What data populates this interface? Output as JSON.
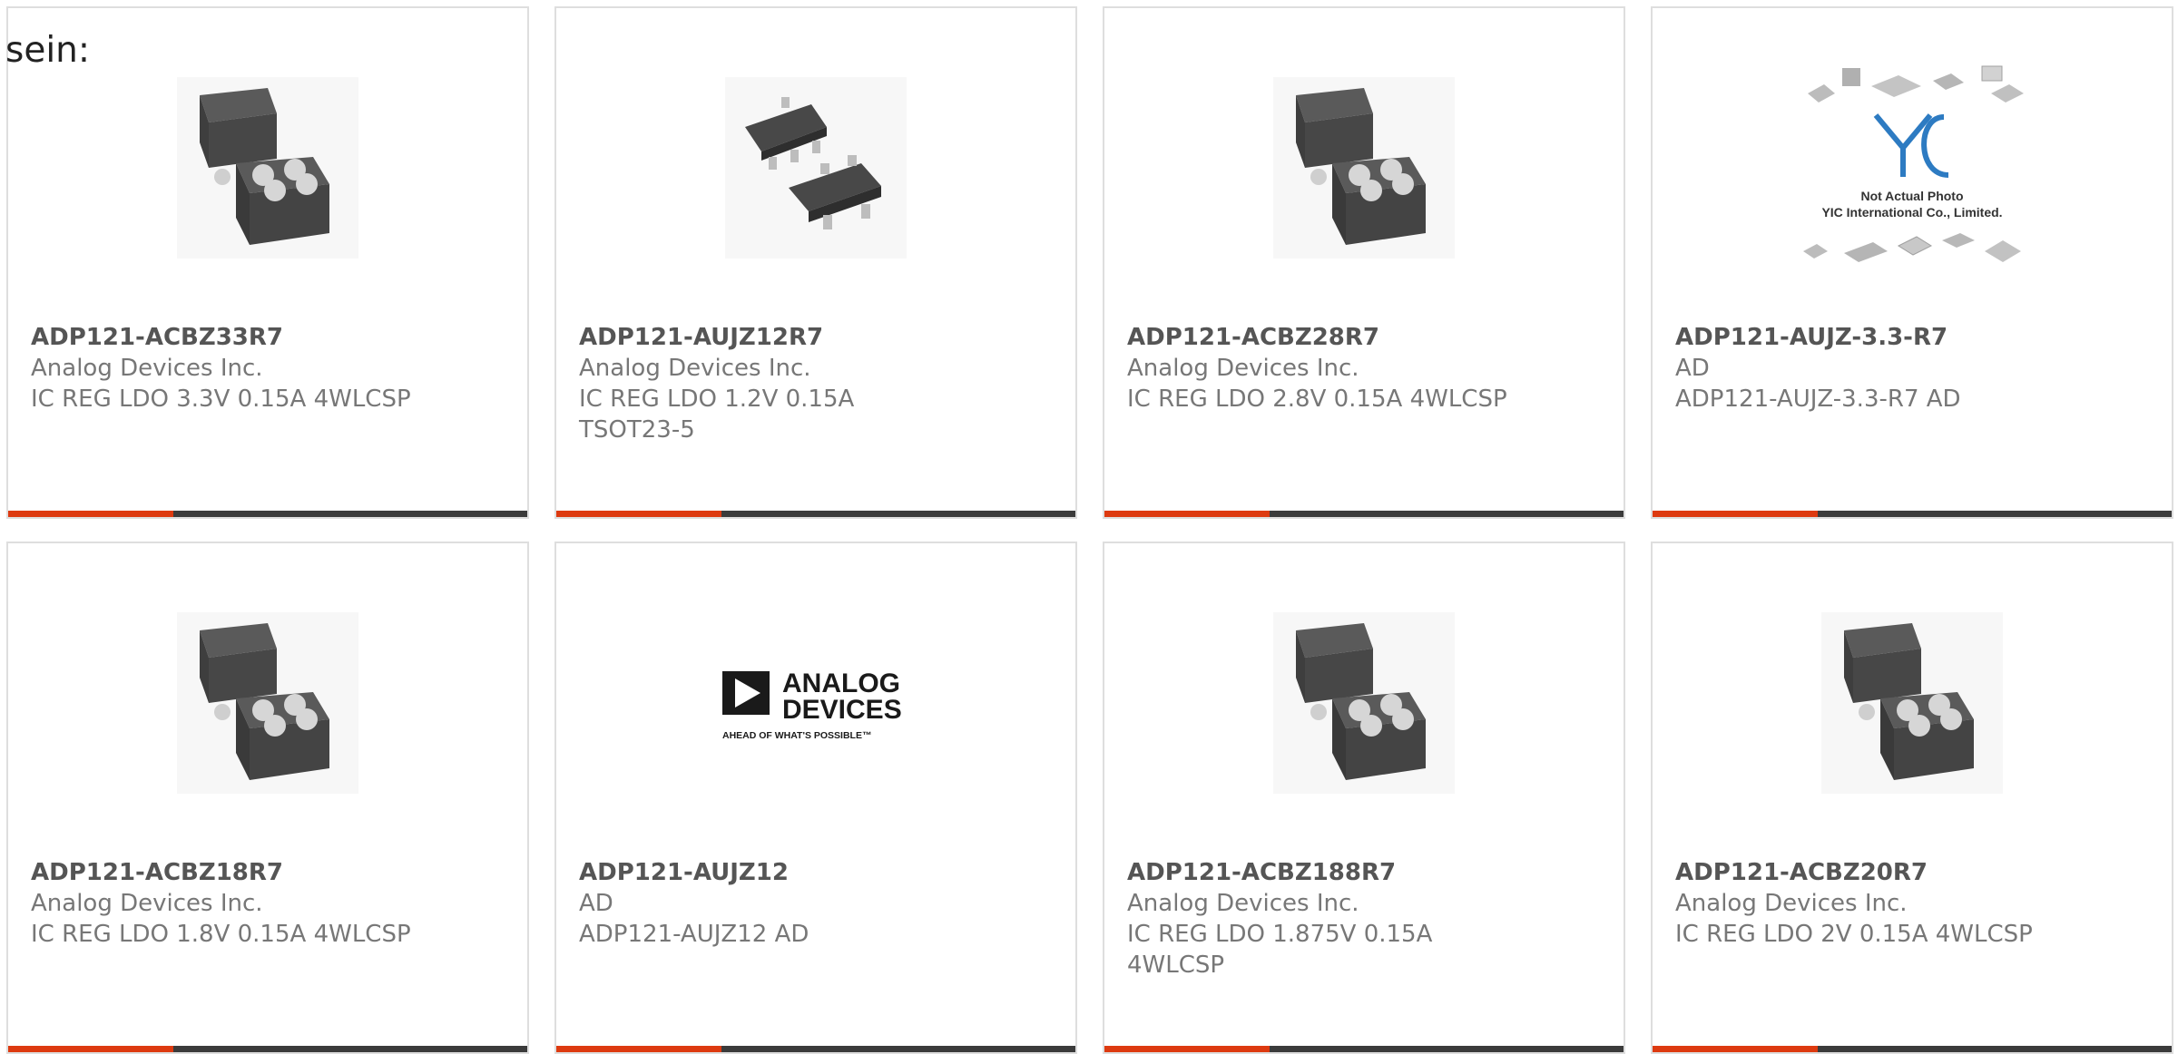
{
  "page": {
    "intro_text": "sein:"
  },
  "colors": {
    "accent_bar": "#dd3a10",
    "dark_bar": "#3b3b3b",
    "card_border": "#dedede",
    "text_gray": "#777777"
  },
  "products": [
    {
      "part_number": "ADP121-ACBZ33R7",
      "manufacturer": "Analog Devices Inc.",
      "description": "IC REG LDO 3.3V 0.15A 4WLCSP",
      "image": "wlcsp-chip-photo"
    },
    {
      "part_number": "ADP121-AUJZ12R7",
      "manufacturer": "Analog Devices Inc.",
      "description": "IC REG LDO 1.2V 0.15A TSOT23-5",
      "image": "tsot23-chip-photo"
    },
    {
      "part_number": "ADP121-ACBZ28R7",
      "manufacturer": "Analog Devices Inc.",
      "description": "IC REG LDO 2.8V 0.15A 4WLCSP",
      "image": "wlcsp-chip-photo"
    },
    {
      "part_number": "ADP121-AUJZ-3.3-R7",
      "manufacturer": "AD",
      "description": "ADP121-AUJZ-3.3-R7 AD",
      "image": "yic-placeholder",
      "image_text": {
        "brand": "YIC",
        "line1": "Not Actual Photo",
        "line2": "YIC International Co., Limited."
      }
    },
    {
      "part_number": "ADP121-ACBZ18R7",
      "manufacturer": "Analog Devices Inc.",
      "description": "IC REG LDO 1.8V 0.15A 4WLCSP",
      "image": "wlcsp-chip-photo"
    },
    {
      "part_number": "ADP121-AUJZ12",
      "manufacturer": "AD",
      "description": "ADP121-AUJZ12 AD",
      "image": "analog-devices-logo",
      "image_text": {
        "line1": "ANALOG",
        "line2": "DEVICES",
        "tagline": "AHEAD OF WHAT'S POSSIBLE™"
      }
    },
    {
      "part_number": "ADP121-ACBZ188R7",
      "manufacturer": "Analog Devices Inc.",
      "description": "IC REG LDO 1.875V 0.15A 4WLCSP",
      "image": "wlcsp-chip-photo"
    },
    {
      "part_number": "ADP121-ACBZ20R7",
      "manufacturer": "Analog Devices Inc.",
      "description": "IC REG LDO 2V 0.15A 4WLCSP",
      "image": "wlcsp-chip-photo"
    }
  ]
}
